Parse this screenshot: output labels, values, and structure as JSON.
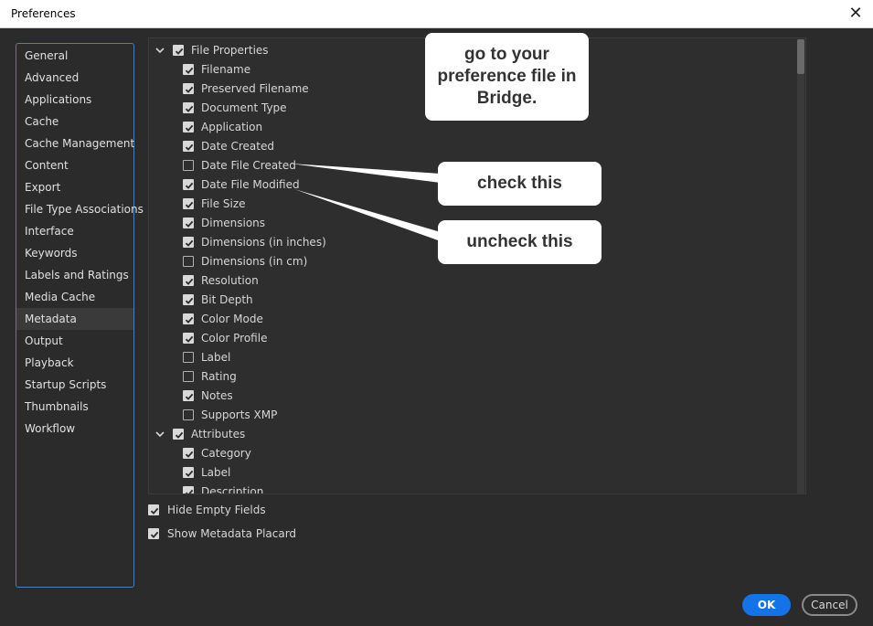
{
  "window": {
    "title": "Preferences",
    "close_glyph": "✕"
  },
  "sidebar": {
    "selected_index": 12,
    "items": [
      {
        "label": "General"
      },
      {
        "label": "Advanced"
      },
      {
        "label": "Applications"
      },
      {
        "label": "Cache"
      },
      {
        "label": "Cache Management"
      },
      {
        "label": "Content"
      },
      {
        "label": "Export"
      },
      {
        "label": "File Type Associations"
      },
      {
        "label": "Interface"
      },
      {
        "label": "Keywords"
      },
      {
        "label": "Labels and Ratings"
      },
      {
        "label": "Media Cache"
      },
      {
        "label": "Metadata"
      },
      {
        "label": "Output"
      },
      {
        "label": "Playback"
      },
      {
        "label": "Startup Scripts"
      },
      {
        "label": "Thumbnails"
      },
      {
        "label": "Workflow"
      }
    ]
  },
  "metadata_panel": {
    "groups": [
      {
        "label": "File Properties",
        "checked": true,
        "expanded": true,
        "items": [
          {
            "label": "Filename",
            "checked": true
          },
          {
            "label": "Preserved Filename",
            "checked": true
          },
          {
            "label": "Document Type",
            "checked": true
          },
          {
            "label": "Application",
            "checked": true
          },
          {
            "label": "Date Created",
            "checked": true
          },
          {
            "label": "Date File Created",
            "checked": false
          },
          {
            "label": "Date File Modified",
            "checked": true
          },
          {
            "label": "File Size",
            "checked": true
          },
          {
            "label": "Dimensions",
            "checked": true
          },
          {
            "label": "Dimensions (in inches)",
            "checked": true
          },
          {
            "label": "Dimensions (in cm)",
            "checked": false
          },
          {
            "label": "Resolution",
            "checked": true
          },
          {
            "label": "Bit Depth",
            "checked": true
          },
          {
            "label": "Color Mode",
            "checked": true
          },
          {
            "label": "Color Profile",
            "checked": true
          },
          {
            "label": "Label",
            "checked": false
          },
          {
            "label": "Rating",
            "checked": false
          },
          {
            "label": "Notes",
            "checked": true
          },
          {
            "label": "Supports XMP",
            "checked": false
          }
        ]
      },
      {
        "label": "Attributes",
        "checked": true,
        "expanded": true,
        "items": [
          {
            "label": "Category",
            "checked": true
          },
          {
            "label": "Label",
            "checked": true
          },
          {
            "label": "Description",
            "checked": true
          }
        ]
      }
    ]
  },
  "options": {
    "hide_empty_fields": {
      "label": "Hide Empty Fields",
      "checked": true
    },
    "show_metadata_placard": {
      "label": "Show Metadata Placard",
      "checked": true
    }
  },
  "buttons": {
    "ok": "OK",
    "cancel": "Cancel"
  },
  "callouts": {
    "top": "go to your preference file in Bridge.",
    "check": "check this",
    "uncheck": "uncheck this"
  },
  "colors": {
    "accent": "#1473e6",
    "sidebar_border": "#4a7fc0",
    "background": "#2b2b2b"
  }
}
